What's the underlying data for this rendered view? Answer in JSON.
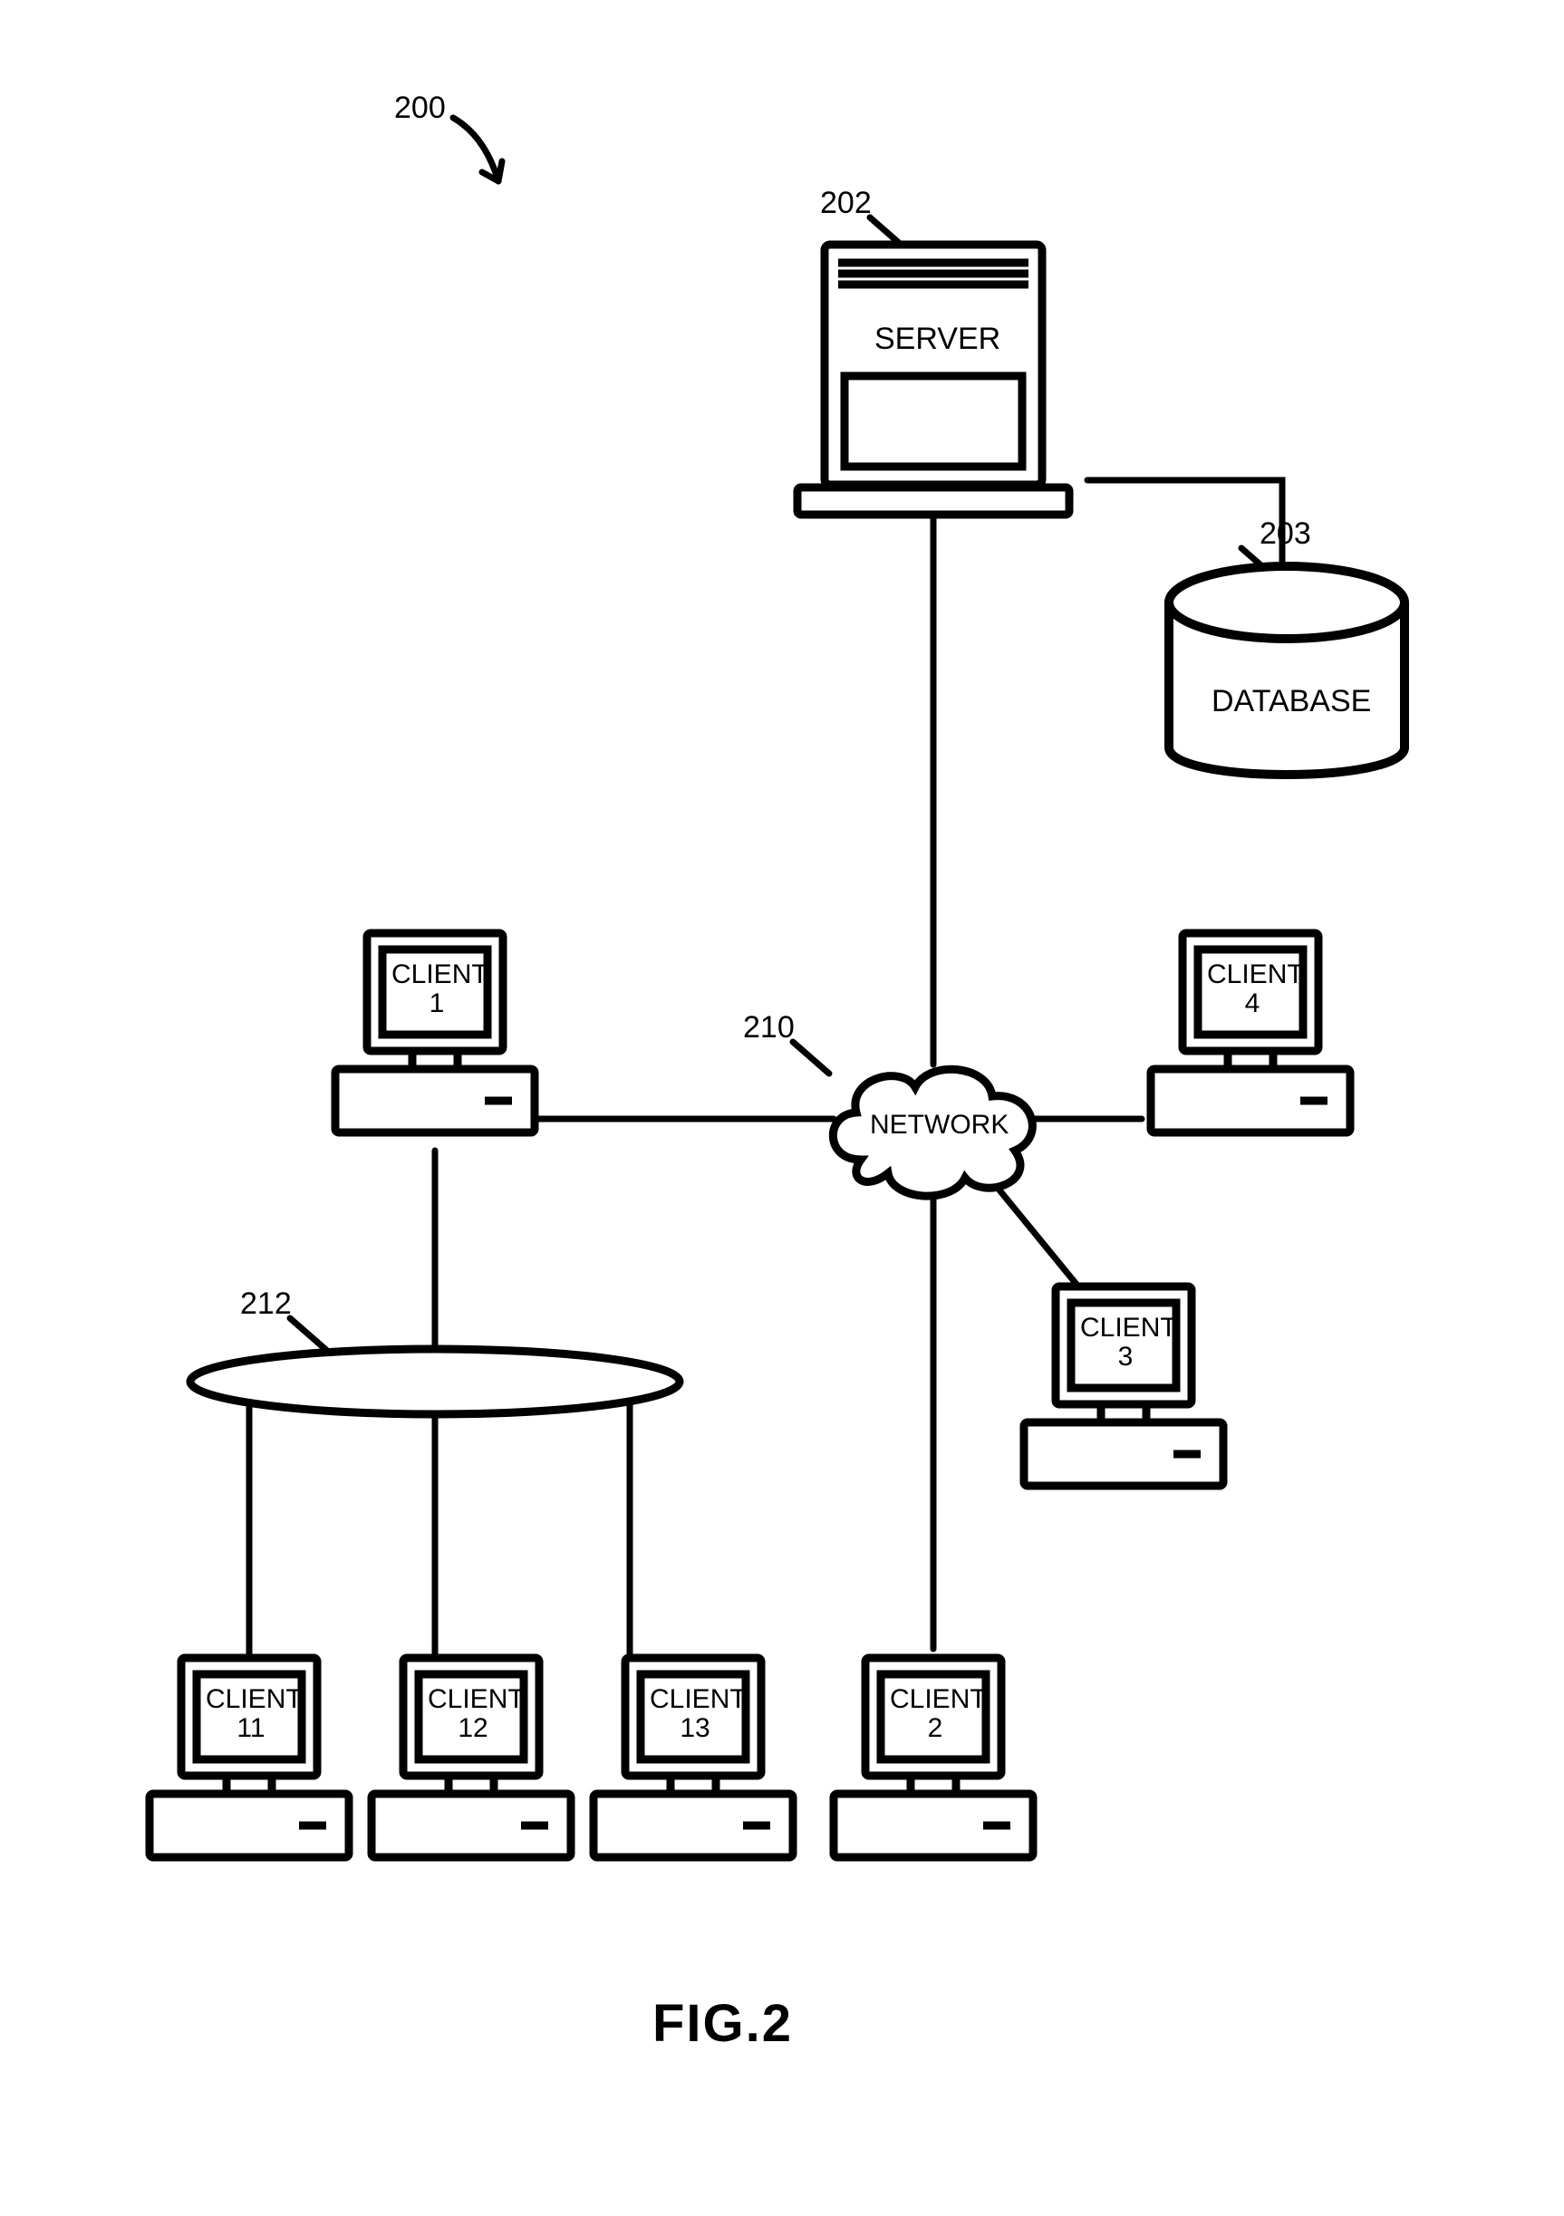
{
  "figure": {
    "caption": "FIG.2",
    "overall_ref": "200"
  },
  "refs": {
    "server": "202",
    "database": "203",
    "network": "210",
    "bus": "212"
  },
  "labels": {
    "server": "SERVER",
    "database": "DATABASE",
    "network": "NETWORK"
  },
  "clients": {
    "c1": "CLIENT\n1",
    "c2": "CLIENT\n2",
    "c3": "CLIENT\n3",
    "c4": "CLIENT\n4",
    "c11": "CLIENT\n11",
    "c12": "CLIENT\n12",
    "c13": "CLIENT\n13"
  }
}
